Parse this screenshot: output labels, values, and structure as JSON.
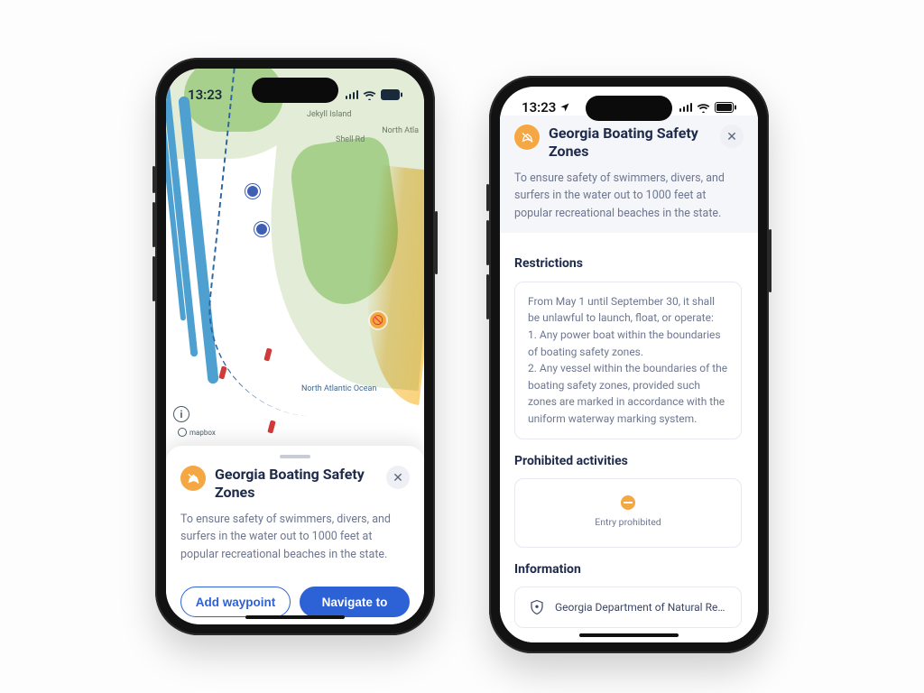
{
  "status": {
    "time": "13:23",
    "location_indicator": true
  },
  "map": {
    "labels": {
      "island": "Jekyll Island",
      "road": "Shell Rd",
      "ocean": "North Atlantic Ocean",
      "north_atla": "North Atla"
    },
    "attribution": "mapbox"
  },
  "zone": {
    "title": "Georgia Boating Safety Zones",
    "summary": "To ensure safety of swimmers, divers, and surfers in the water out to 1000 feet at popular recreational beaches in the state.",
    "icon": "no-boating-zone"
  },
  "sections": {
    "restrictions": {
      "heading": "Restrictions",
      "body": "From May 1 until September 30, it shall be unlawful to launch, float, or operate:\n1. Any power boat within the boundaries of boating safety zones.\n2. Any vessel within the boundaries of the boating safety zones, provided such zones are marked in accordance with the uniform waterway marking system."
    },
    "prohibited": {
      "heading": "Prohibited activities",
      "item": "Entry prohibited"
    },
    "information": {
      "heading": "Information",
      "source": "Georgia Department of Natural Resou…"
    }
  },
  "actions": {
    "add_waypoint": "Add waypoint",
    "navigate": "Navigate to"
  }
}
